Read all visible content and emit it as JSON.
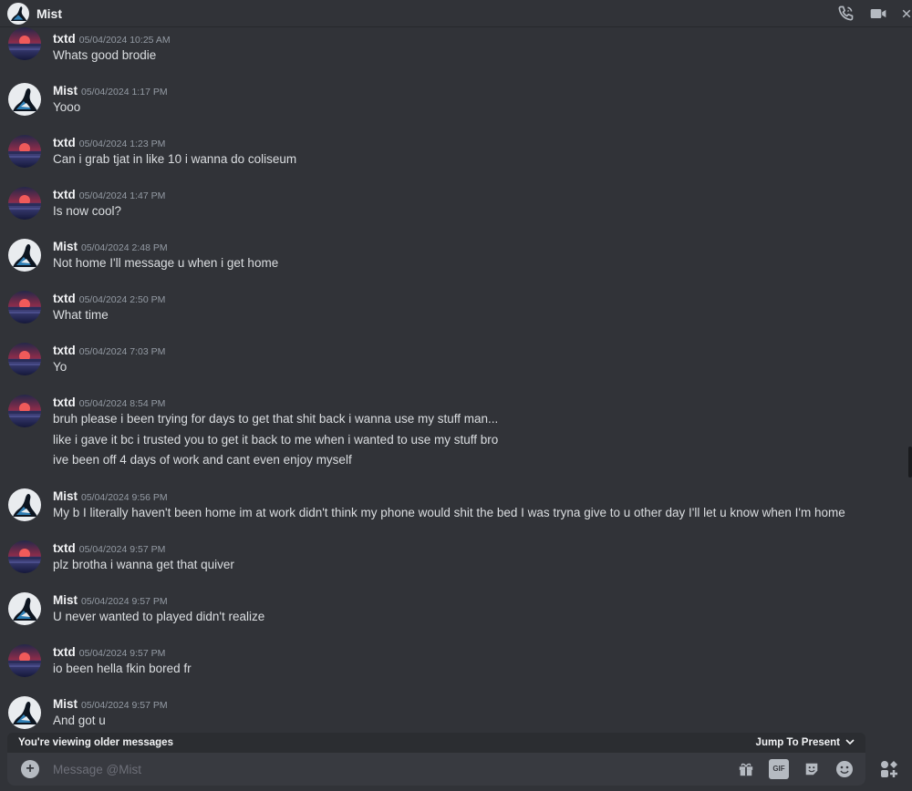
{
  "header": {
    "title": "Mist"
  },
  "messages": [
    {
      "author": "txtd",
      "avatar": "txtd",
      "time": "05/04/2024 10:25 AM",
      "lines": [
        "Whats good brodie"
      ]
    },
    {
      "author": "Mist",
      "avatar": "mist",
      "time": "05/04/2024 1:17 PM",
      "lines": [
        "Yooo"
      ]
    },
    {
      "author": "txtd",
      "avatar": "txtd",
      "time": "05/04/2024 1:23 PM",
      "lines": [
        "Can i grab tjat in like 10 i wanna do coliseum"
      ]
    },
    {
      "author": "txtd",
      "avatar": "txtd",
      "time": "05/04/2024 1:47 PM",
      "lines": [
        "Is now cool?"
      ]
    },
    {
      "author": "Mist",
      "avatar": "mist",
      "time": "05/04/2024 2:48 PM",
      "lines": [
        "Not home I'll message u when i get home"
      ]
    },
    {
      "author": "txtd",
      "avatar": "txtd",
      "time": "05/04/2024 2:50 PM",
      "lines": [
        "What time"
      ]
    },
    {
      "author": "txtd",
      "avatar": "txtd",
      "time": "05/04/2024 7:03 PM",
      "lines": [
        "Yo"
      ]
    },
    {
      "author": "txtd",
      "avatar": "txtd",
      "time": "05/04/2024 8:54 PM",
      "lines": [
        "bruh please i been trying for days to get that shit back i wanna use my stuff man...",
        "like i gave it bc i trusted you to get it back to me when i wanted to use my stuff bro",
        "ive been off 4 days of work and cant even enjoy myself"
      ]
    },
    {
      "author": "Mist",
      "avatar": "mist",
      "time": "05/04/2024 9:56 PM",
      "lines": [
        "My b I literally haven't been home im at work didn't think my phone would shit the bed I was tryna give to u other day I'll let u know when I'm home"
      ]
    },
    {
      "author": "txtd",
      "avatar": "txtd",
      "time": "05/04/2024 9:57 PM",
      "lines": [
        "plz brotha i wanna get that quiver"
      ]
    },
    {
      "author": "Mist",
      "avatar": "mist",
      "time": "05/04/2024 9:57 PM",
      "lines": [
        "U never wanted to played didn't realize"
      ]
    },
    {
      "author": "txtd",
      "avatar": "txtd",
      "time": "05/04/2024 9:57 PM",
      "lines": [
        "io been hella fkin bored fr"
      ]
    },
    {
      "author": "Mist",
      "avatar": "mist",
      "time": "05/04/2024 9:57 PM",
      "lines": [
        "And got u"
      ]
    }
  ],
  "older_bar": {
    "notice": "You're viewing older messages",
    "jump_label": "Jump To Present"
  },
  "composer": {
    "placeholder": "Message @Mist"
  },
  "colors": {
    "background": "#313338",
    "composer": "#383a40",
    "author": "#f2f3f5",
    "timestamp": "#949ba4"
  }
}
